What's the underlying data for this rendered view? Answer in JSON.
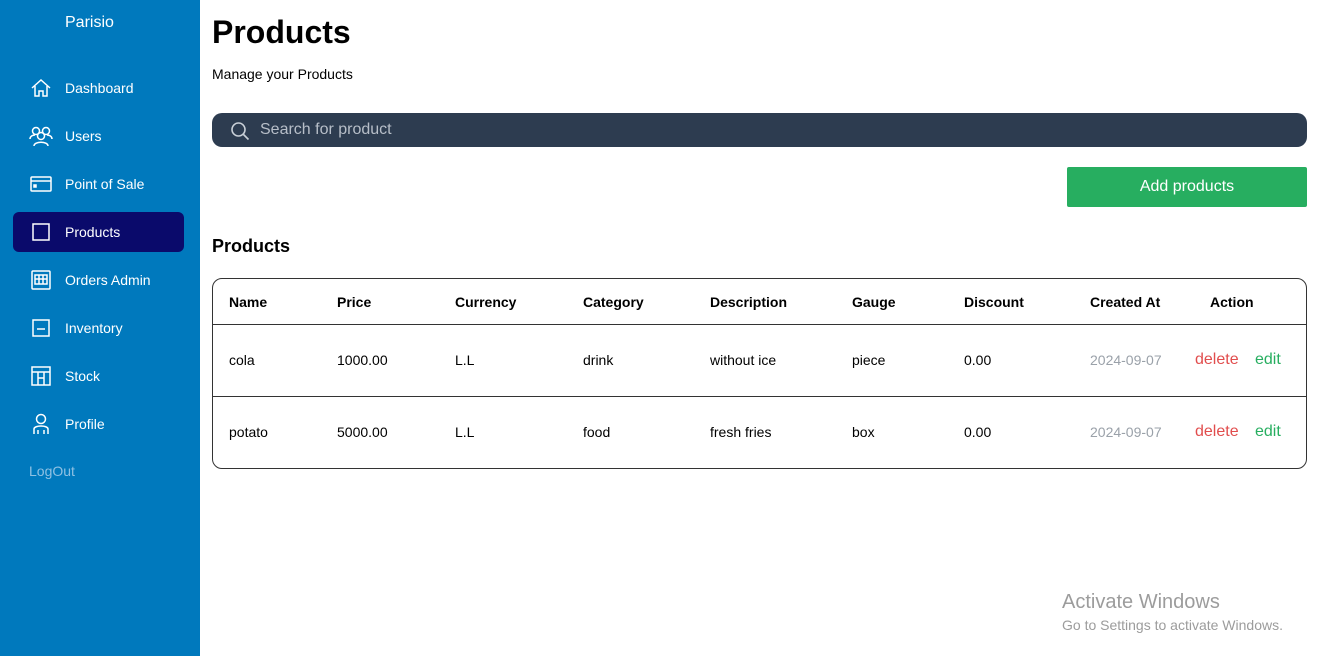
{
  "sidebar": {
    "brand": "Parisio",
    "items": [
      {
        "label": "Dashboard",
        "icon": "home-icon"
      },
      {
        "label": "Users",
        "icon": "users-icon"
      },
      {
        "label": "Point of Sale",
        "icon": "card-icon"
      },
      {
        "label": "Products",
        "icon": "square-icon",
        "active": true
      },
      {
        "label": "Orders Admin",
        "icon": "orders-icon"
      },
      {
        "label": "Inventory",
        "icon": "inventory-icon"
      },
      {
        "label": "Stock",
        "icon": "stock-icon"
      },
      {
        "label": "Profile",
        "icon": "person-icon"
      }
    ],
    "logout": "LogOut"
  },
  "header": {
    "title": "Products",
    "subtitle": "Manage your Products"
  },
  "search": {
    "placeholder": "Search for product"
  },
  "actions": {
    "add_label": "Add products"
  },
  "table": {
    "title": "Products",
    "columns": [
      "Name",
      "Price",
      "Currency",
      "Category",
      "Description",
      "Gauge",
      "Discount",
      "Created At",
      "Action"
    ],
    "rows": [
      {
        "name": "cola",
        "price": "1000.00",
        "currency": "L.L",
        "category": "drink",
        "description": "without ice",
        "gauge": "piece",
        "discount": "0.00",
        "created_at": "2024-09-07",
        "delete": "delete",
        "edit": "edit"
      },
      {
        "name": "potato",
        "price": "5000.00",
        "currency": "L.L",
        "category": "food",
        "description": "fresh fries",
        "gauge": "box",
        "discount": "0.00",
        "created_at": "2024-09-07",
        "delete": "delete",
        "edit": "edit"
      }
    ]
  },
  "watermark": {
    "title": "Activate Windows",
    "subtitle": "Go to Settings to activate Windows."
  },
  "colors": {
    "sidebar": "#0079bd",
    "active": "#0a0a6b",
    "search_bg": "#2d3c50",
    "add_button": "#27ae60",
    "delete": "#e14d4d",
    "edit": "#27ae60"
  }
}
